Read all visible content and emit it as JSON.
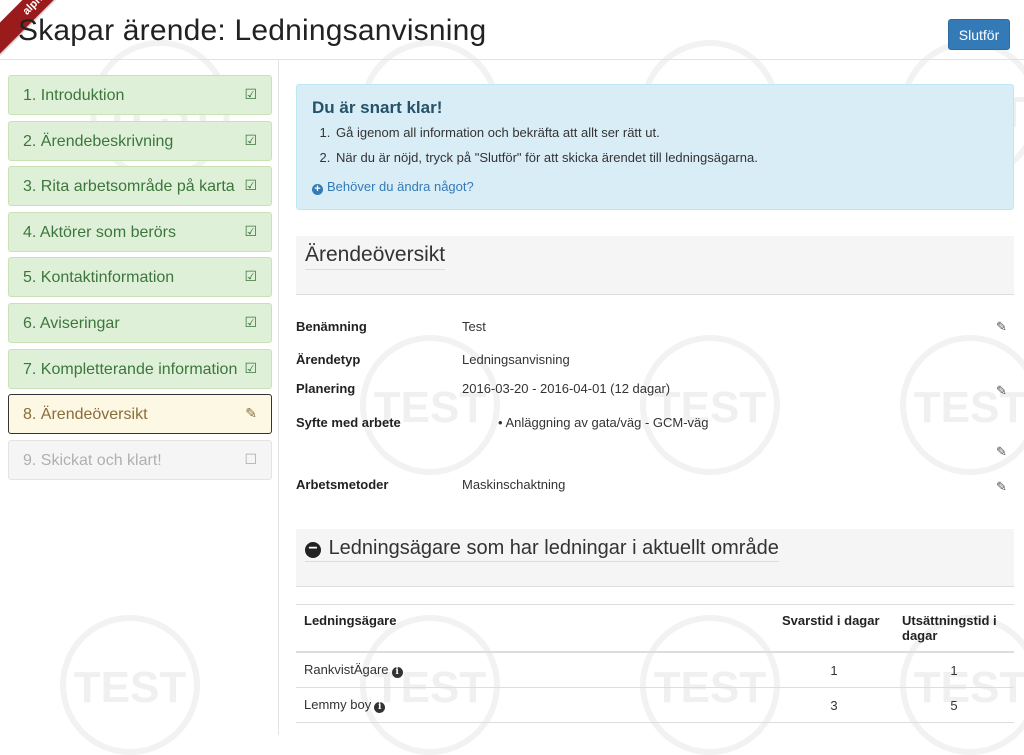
{
  "header": {
    "ribbon": "alpha",
    "title": "Skapar ärende: Ledningsanvisning",
    "finish_button": "Slutför"
  },
  "steps": [
    {
      "label": "1. Introduktion",
      "state": "done",
      "icon": "check-square-icon"
    },
    {
      "label": "2. Ärendebeskrivning",
      "state": "done",
      "icon": "check-square-icon"
    },
    {
      "label": "3. Rita arbetsområde på karta",
      "state": "done",
      "icon": "check-square-icon"
    },
    {
      "label": "4. Aktörer som berörs",
      "state": "done",
      "icon": "check-square-icon"
    },
    {
      "label": "5. Kontaktinformation",
      "state": "done",
      "icon": "check-square-icon"
    },
    {
      "label": "6. Aviseringar",
      "state": "done",
      "icon": "check-square-icon"
    },
    {
      "label": "7. Kompletterande information",
      "state": "done",
      "icon": "check-square-icon"
    },
    {
      "label": "8. Ärendeöversikt",
      "state": "current",
      "icon": "edit-icon"
    },
    {
      "label": "9. Skickat och klart!",
      "state": "disabled",
      "icon": "empty-square-icon"
    }
  ],
  "info": {
    "title": "Du är snart klar!",
    "items": [
      "Gå igenom all information och bekräfta att allt ser rätt ut.",
      "När du är nöjd, tryck på \"Slutför\" för att skicka ärendet till ledningsägarna."
    ],
    "link": "Behöver du ändra något?"
  },
  "overview": {
    "title": "Ärendeöversikt",
    "rows": [
      {
        "label": "Benämning",
        "value": "Test"
      },
      {
        "label": "Ärendetyp",
        "value": "Ledningsanvisning"
      },
      {
        "label": "Planering",
        "value": "2016-03-20 - 2016-04-01 (12 dagar)"
      },
      {
        "label": "Syfte med arbete",
        "value": "Anläggning av gata/väg - GCM-väg"
      },
      {
        "label": "Arbetsmetoder",
        "value": "Maskinschaktning"
      }
    ]
  },
  "owners": {
    "title": "Ledningsägare som har ledningar i aktuellt område",
    "columns": [
      "Ledningsägare",
      "Svarstid i dagar",
      "Utsättningstid i dagar"
    ],
    "rows": [
      {
        "name": "RankvistÄgare",
        "response": "1",
        "setout": "1"
      },
      {
        "name": "Lemmy boy",
        "response": "3",
        "setout": "5"
      }
    ]
  },
  "colors": {
    "primary": "#337ab7",
    "success_bg": "#dff0d8",
    "success_text": "#3c763d",
    "warning_bg": "#fcf8e3",
    "info_bg": "#d9edf7",
    "ribbon": "#9a1b1b"
  }
}
